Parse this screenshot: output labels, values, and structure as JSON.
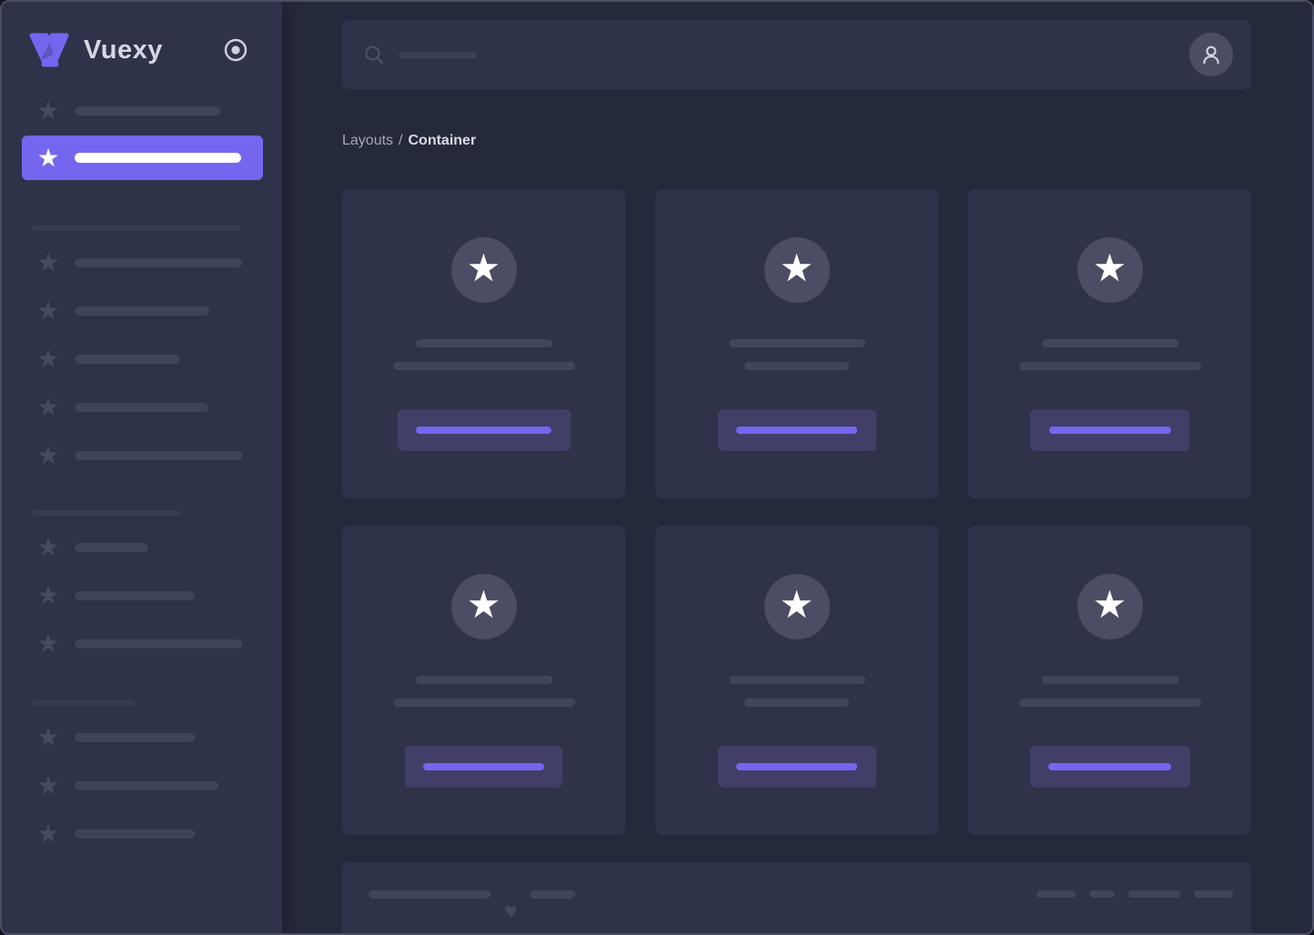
{
  "app": {
    "name": "Vuexy"
  },
  "breadcrumb": {
    "section": "Layouts",
    "separator": "/",
    "page": "Container"
  },
  "icons": {
    "star": "★",
    "heart": "♥",
    "search": "magnifier",
    "user": "person-silhouette",
    "menu_pin": "radio-circle-dot",
    "logo": "vuexy-v-mark"
  },
  "colors": {
    "primary": "#7367f0",
    "background": "#25293c",
    "surface": "#2f3349",
    "skeleton": "#3f4358",
    "skeleton_dim": "#383c51",
    "card_bar": "#41455b",
    "avatar_circle": "#4a4d63",
    "button_bg": "#413e67",
    "border": "#4a4e66"
  }
}
